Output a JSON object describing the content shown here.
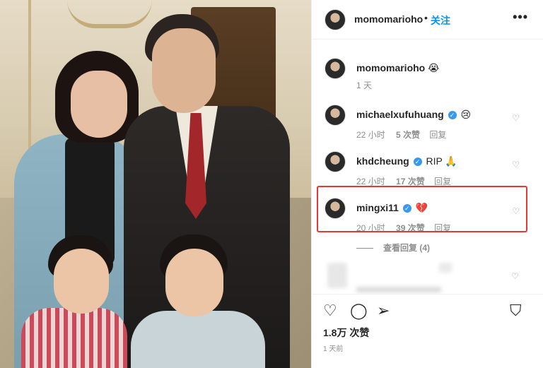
{
  "post": {
    "author": "momomarioho",
    "separator": "•",
    "follow_label": "关注",
    "more_label": "•••"
  },
  "comments": [
    {
      "username": "momomarioho",
      "text": "😭",
      "verified": false,
      "time": "1 天",
      "likes": "",
      "reply": ""
    },
    {
      "username": "michaelxufuhuang",
      "text": "😢",
      "verified": true,
      "time": "22 小时",
      "likes": "5 次赞",
      "reply": "回复"
    },
    {
      "username": "khdcheung",
      "text": "RIP 🙏",
      "verified": true,
      "time": "22 小时",
      "likes": "17 次赞",
      "reply": "回复"
    },
    {
      "username": "mingxi11",
      "text": "💔",
      "verified": true,
      "time": "20 小时",
      "likes": "39 次赞",
      "reply": "回复"
    }
  ],
  "view_replies": "查看回复 (4)",
  "footer": {
    "likes": "1.8万 次赞",
    "time": "1 天前"
  },
  "icons": {
    "heart": "♡",
    "comment": "◯",
    "share": "➢",
    "bookmark": "⛉"
  },
  "colors": {
    "follow": "#0095f6",
    "verified": "#3897f0",
    "highlight": "#e53935"
  }
}
